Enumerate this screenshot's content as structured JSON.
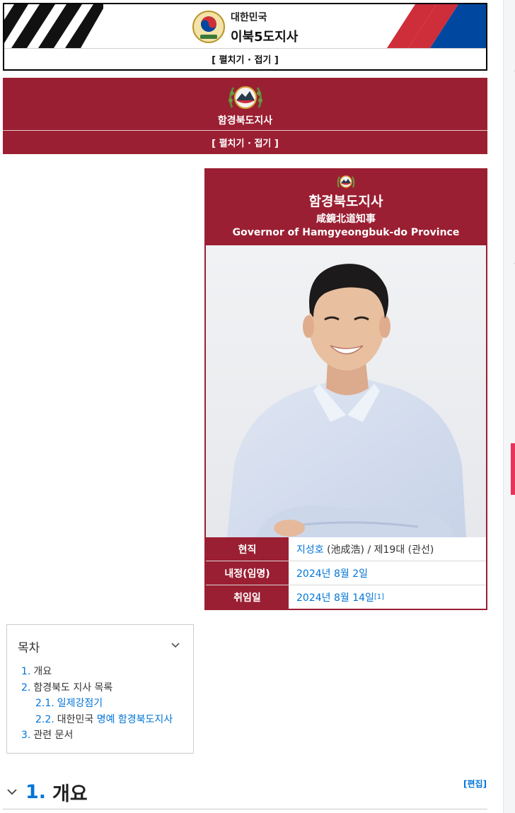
{
  "nav_box_1": {
    "subtitle": "대한민국",
    "title": "이북5도지사",
    "toggle": "[ 펼치기 · 접기 ]"
  },
  "nav_box_2": {
    "title": "함경북도지사",
    "toggle": "[ 펼치기 · 접기 ]"
  },
  "infobox": {
    "title_ko": "함경북도지사",
    "title_hanja": "咸鏡北道知事",
    "title_en": "Governor of Hamgyeongbuk-do Province",
    "photo_icon": "portrait-photo",
    "rows": [
      {
        "label": "현직",
        "value_link": "지성호",
        "value_rest": " (池成浩) / 제19대 (관선)",
        "footnote": ""
      },
      {
        "label": "내정(임명)",
        "value_link": "2024년 8월 2일",
        "value_rest": "",
        "footnote": ""
      },
      {
        "label": "취임일",
        "value_link": "2024년 8월 14일",
        "value_rest": "",
        "footnote": "[1]"
      }
    ]
  },
  "toc": {
    "heading": "목차",
    "items": [
      {
        "num": "1.",
        "text": "개요",
        "link": ""
      },
      {
        "num": "2.",
        "text": "함경북도 지사 목록",
        "link": ""
      },
      {
        "num": "2.1.",
        "text": "",
        "link": "일제강점기"
      },
      {
        "num": "2.2.",
        "text": "대한민국 ",
        "link": "명예 함경북도지사"
      },
      {
        "num": "3.",
        "text": "관련 문서",
        "link": ""
      }
    ]
  },
  "section": {
    "number": "1.",
    "title": "개요",
    "edit_label": "[편집]"
  },
  "colors": {
    "maroon": "#9b1f32",
    "link_blue": "#0275d8",
    "flag_red": "#cd2e3a",
    "flag_blue": "#0047a0"
  }
}
